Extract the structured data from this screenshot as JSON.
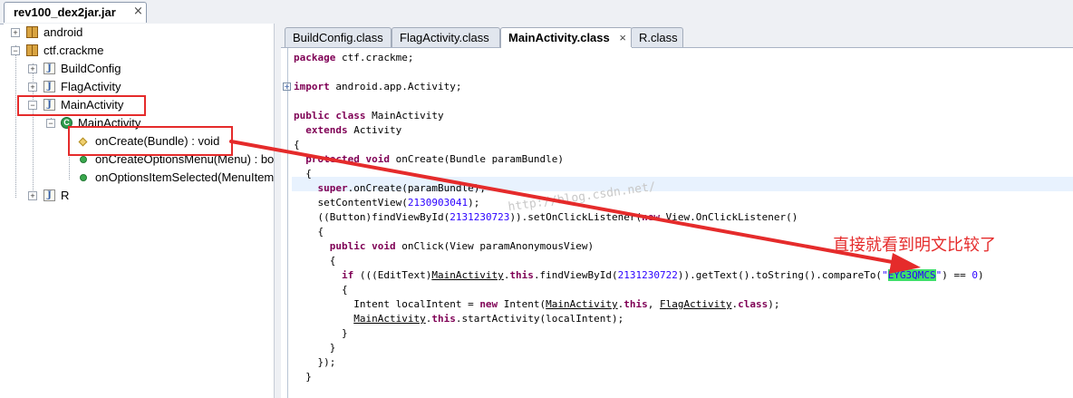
{
  "file_tab": {
    "title": "rev100_dex2jar.jar",
    "close": "×"
  },
  "tree": {
    "android": "android",
    "ctf_crackme": "ctf.crackme",
    "build_config": "BuildConfig",
    "flag_activity": "FlagActivity",
    "main_activity_file": "MainActivity",
    "main_activity_class": "MainActivity",
    "on_create": "onCreate(Bundle) : void",
    "on_create_options_menu": "onCreateOptionsMenu(Menu) : bo",
    "on_options_item_selected": "onOptionsItemSelected(MenuItem",
    "r": "R"
  },
  "editor_tabs": [
    {
      "label": "BuildConfig.class"
    },
    {
      "label": "FlagActivity.class"
    },
    {
      "label": "MainActivity.class",
      "active": true,
      "close": "×"
    },
    {
      "label": "R.class"
    }
  ],
  "code": {
    "l01": "package ctf.crackme;",
    "l02_kw": "import",
    "l02": " android.app.Activity;",
    "l03_kw1": "public",
    "l03_kw2": "class",
    "l03": " MainActivity",
    "l04_kw": "extends",
    "l04": " Activity",
    "l05": "{",
    "l06_kw1": "protected",
    "l06_kw2": "void",
    "l06": " onCreate(Bundle paramBundle)",
    "l07": "{",
    "l08_kw": "super",
    "l08": ".onCreate(paramBundle);",
    "l09_a": "setContentView(",
    "l09_num": "2130903041",
    "l09_b": ");",
    "l10_a": "((Button)findViewById(",
    "l10_num": "2131230723",
    "l10_b": ")).setOnClickListener(",
    "l10_kw": "new",
    "l10_c": " View.OnClickListener()",
    "l11": "{",
    "l12_kw1": "public",
    "l12_kw2": "void",
    "l12": " onClick(View paramAnonymousView)",
    "l13": "{",
    "l14_kw": "if",
    "l14_a": " (((EditText)",
    "l14_u": "MainActivity",
    "l14_b": ".",
    "l14_kw2": "this",
    "l14_c": ".findViewById(",
    "l14_num": "2131230722",
    "l14_d": ")).getText().toString().compareTo(",
    "l14_q1": "\"",
    "l14_str": "EYG3QMCS",
    "l14_q2": "\"",
    "l14_e": ") == ",
    "l14_zero": "0",
    "l14_f": ")",
    "l15": "{",
    "l16_a": "Intent localIntent = ",
    "l16_kw": "new",
    "l16_b": " Intent(",
    "l16_u1": "MainActivity",
    "l16_c": ".",
    "l16_kw2": "this",
    "l16_d": ", ",
    "l16_u2": "FlagActivity",
    "l16_e": ".",
    "l16_kw3": "class",
    "l16_f": ");",
    "l17_u": "MainActivity",
    "l17_a": ".",
    "l17_kw": "this",
    "l17_b": ".startActivity(localIntent);",
    "l18": "}",
    "l19": "}",
    "l20": "});",
    "l21": "}"
  },
  "watermark": "http://blog.csdn.net/",
  "annotation": "直接就看到明文比较了",
  "colors": {
    "annotation_red": "#e52b2b",
    "highlight_green": "#3ee06a",
    "keyword": "#7f0055",
    "literal": "#2a00ff"
  }
}
